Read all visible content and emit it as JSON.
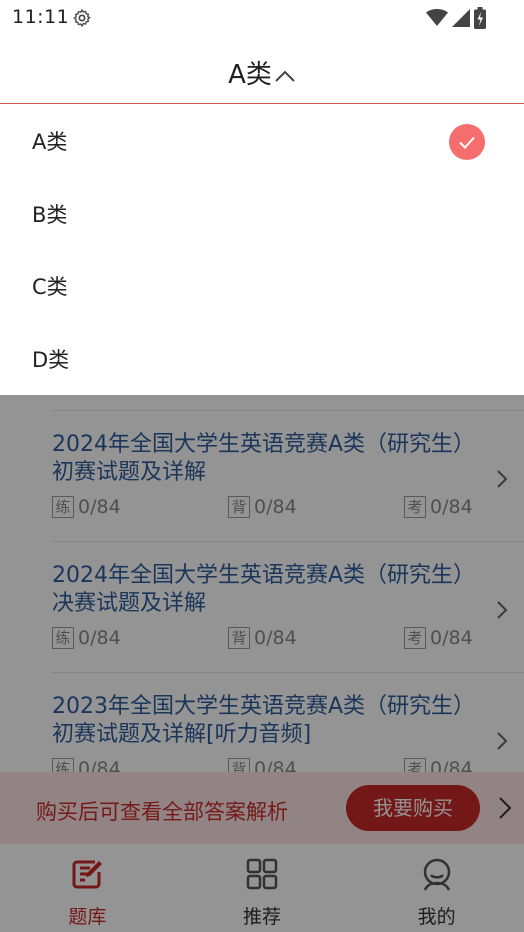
{
  "status_bar": {
    "time": "11:11"
  },
  "header": {
    "title": "A类"
  },
  "dropdown": {
    "items": [
      {
        "label": "A类",
        "selected": true
      },
      {
        "label": "B类",
        "selected": false
      },
      {
        "label": "C类",
        "selected": false
      },
      {
        "label": "D类",
        "selected": false
      }
    ]
  },
  "exams": [
    {
      "title": "2024年全国大学生英语竞赛A类（研究生）初赛试题及详解",
      "practice": "0/84",
      "recite": "0/84",
      "test": "0/84"
    },
    {
      "title": "2024年全国大学生英语竞赛A类（研究生）决赛试题及详解",
      "practice": "0/84",
      "recite": "0/84",
      "test": "0/84"
    },
    {
      "title": "2023年全国大学生英语竞赛A类（研究生）初赛试题及详解[听力音频]",
      "practice": "0/84",
      "recite": "0/84",
      "test": "0/84"
    }
  ],
  "stat_tags": {
    "practice": "练",
    "recite": "背",
    "test": "考"
  },
  "purchase": {
    "text": "购买后可查看全部答案解析",
    "button": "我要购买"
  },
  "nav": [
    {
      "label": "题库",
      "icon": "edit-icon",
      "active": true
    },
    {
      "label": "推荐",
      "icon": "grid-icon",
      "active": false
    },
    {
      "label": "我的",
      "icon": "user-icon",
      "active": false
    }
  ],
  "colors": {
    "accent": "#c62828",
    "check": "#f56d6d",
    "link": "#2f5e9c"
  }
}
